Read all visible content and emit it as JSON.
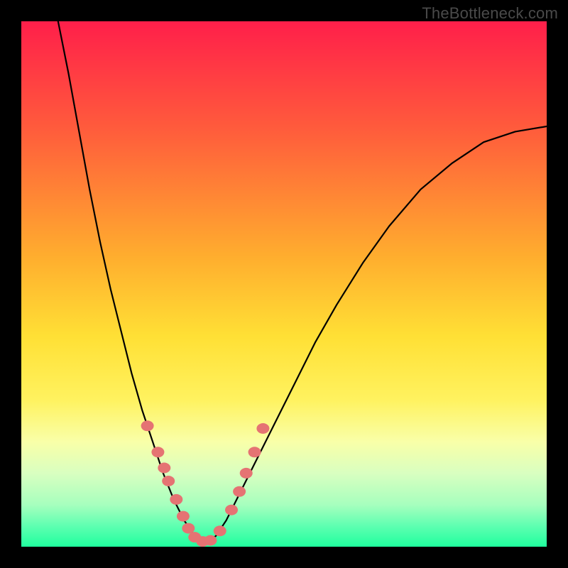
{
  "watermark": {
    "text": "TheBottleneck.com"
  },
  "colors": {
    "frame": "#000000",
    "gradient_stops": [
      {
        "offset": 0.0,
        "color": "#ff1f4a"
      },
      {
        "offset": 0.2,
        "color": "#ff5a3c"
      },
      {
        "offset": 0.45,
        "color": "#ffae2e"
      },
      {
        "offset": 0.6,
        "color": "#ffe035"
      },
      {
        "offset": 0.72,
        "color": "#fff25f"
      },
      {
        "offset": 0.8,
        "color": "#f9ffa8"
      },
      {
        "offset": 0.86,
        "color": "#d9ffc0"
      },
      {
        "offset": 0.92,
        "color": "#a7ffbe"
      },
      {
        "offset": 0.96,
        "color": "#5fffb1"
      },
      {
        "offset": 1.0,
        "color": "#20ff9e"
      }
    ],
    "curve": "#000000",
    "dots": "#e57373"
  },
  "chart_data": {
    "type": "line",
    "title": "",
    "xlabel": "",
    "ylabel": "",
    "xlim": [
      0,
      1
    ],
    "ylim": [
      0,
      1
    ],
    "legend": false,
    "grid": false,
    "series": [
      {
        "name": "bottleneck-curve",
        "x": [
          0.07,
          0.09,
          0.11,
          0.13,
          0.15,
          0.17,
          0.19,
          0.21,
          0.23,
          0.25,
          0.27,
          0.29,
          0.31,
          0.33,
          0.35,
          0.37,
          0.39,
          0.41,
          0.44,
          0.48,
          0.52,
          0.56,
          0.6,
          0.65,
          0.7,
          0.76,
          0.82,
          0.88,
          0.94,
          1.0
        ],
        "y": [
          1.0,
          0.9,
          0.79,
          0.68,
          0.58,
          0.49,
          0.41,
          0.33,
          0.26,
          0.2,
          0.14,
          0.09,
          0.05,
          0.02,
          0.01,
          0.02,
          0.05,
          0.09,
          0.15,
          0.23,
          0.31,
          0.39,
          0.46,
          0.54,
          0.61,
          0.68,
          0.73,
          0.77,
          0.79,
          0.8
        ]
      }
    ],
    "highlight_points": {
      "name": "marker-dots",
      "x": [
        0.24,
        0.26,
        0.272,
        0.28,
        0.295,
        0.308,
        0.318,
        0.33,
        0.345,
        0.36,
        0.378,
        0.4,
        0.415,
        0.428,
        0.444,
        0.46
      ],
      "y": [
        0.23,
        0.18,
        0.15,
        0.125,
        0.09,
        0.058,
        0.035,
        0.018,
        0.01,
        0.012,
        0.03,
        0.07,
        0.105,
        0.14,
        0.18,
        0.225
      ]
    }
  }
}
